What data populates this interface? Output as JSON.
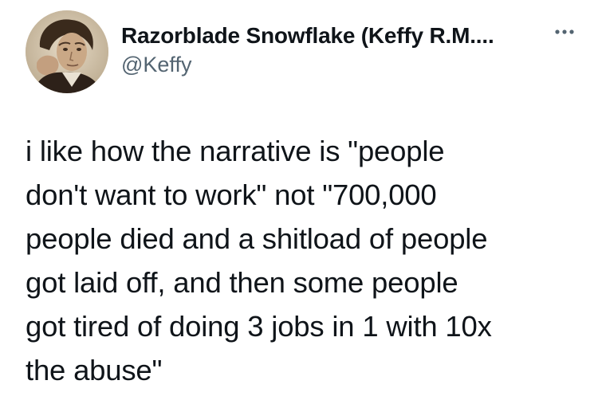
{
  "author": {
    "display_name": "Razorblade Snowflake (Keffy R.M....",
    "handle": "@Keffy",
    "avatar_icon": "sepia-portrait-avatar"
  },
  "actions": {
    "more_icon": "more-horizontal-icon"
  },
  "tweet": {
    "text": "i like how the narrative is \"people\ndon't want to work\" not \"700,000\npeople died and a shitload of people\ngot laid off, and then some people\ngot tired of doing 3 jobs in 1 with 10x\nthe abuse\""
  },
  "colors": {
    "text_primary": "#0f1419",
    "text_secondary": "#536471",
    "background": "#ffffff"
  }
}
